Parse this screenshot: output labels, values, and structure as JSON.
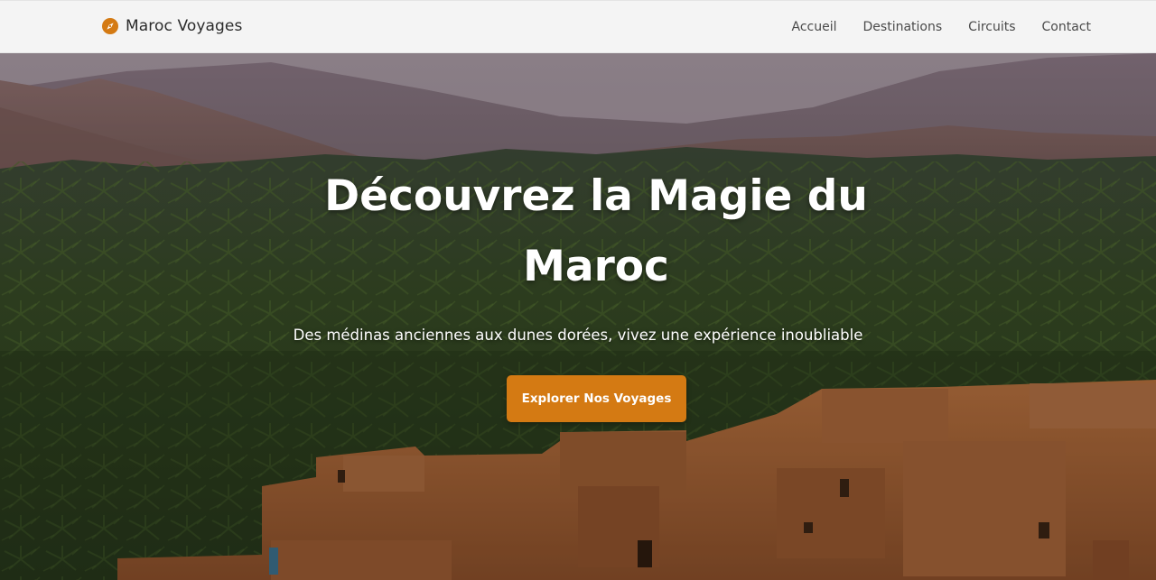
{
  "navbar": {
    "brand": {
      "icon": "compass-icon",
      "name": "Maroc Voyages"
    },
    "links": [
      {
        "label": "Accueil"
      },
      {
        "label": "Destinations"
      },
      {
        "label": "Circuits"
      },
      {
        "label": "Contact"
      }
    ]
  },
  "hero": {
    "title": "Découvrez la Magie du Maroc",
    "subtitle": "Des médinas anciennes aux dunes dorées, vivez une expérience inoubliable",
    "cta_label": "Explorer Nos Voyages"
  },
  "colors": {
    "accent": "#d47a13",
    "navbar_bg": "#f4f4f4",
    "brand_text": "#2b2b2b",
    "nav_link": "#4a4a4a",
    "hero_text": "#ffffff"
  }
}
